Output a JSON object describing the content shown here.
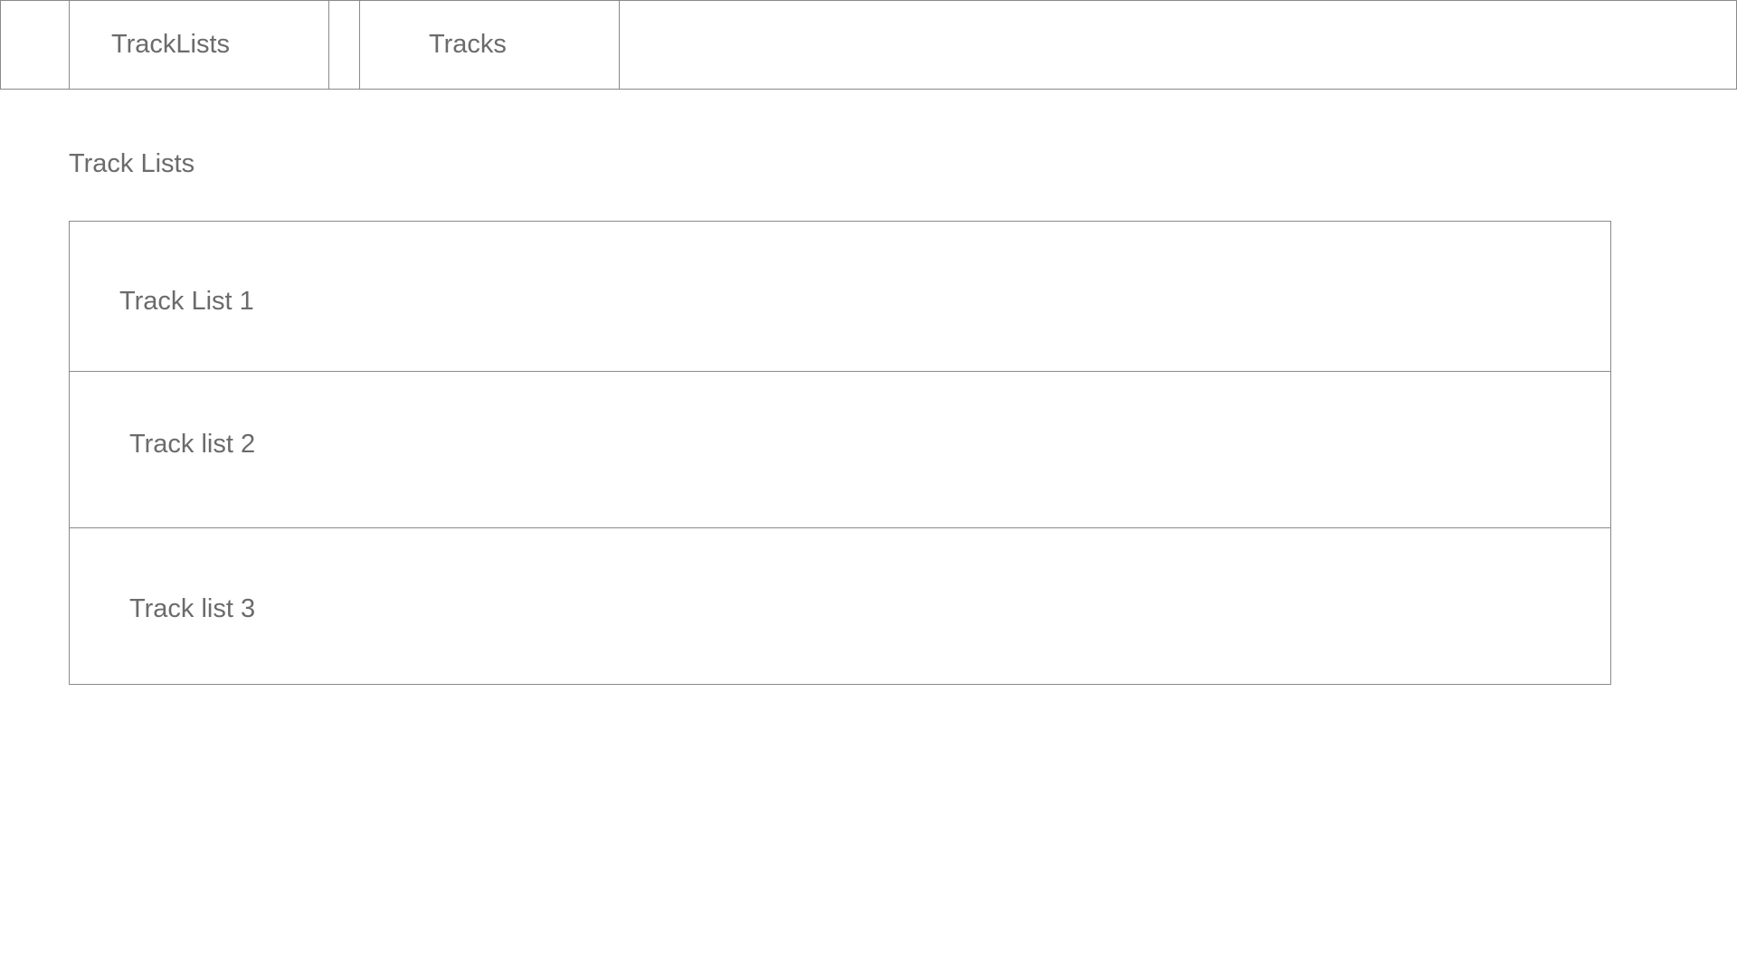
{
  "nav": {
    "tabs": [
      {
        "label": "TrackLists"
      },
      {
        "label": "Tracks"
      }
    ]
  },
  "main": {
    "title": "Track Lists",
    "track_lists": [
      {
        "label": "Track List 1"
      },
      {
        "label": "Track list 2"
      },
      {
        "label": "Track list 3"
      }
    ]
  }
}
